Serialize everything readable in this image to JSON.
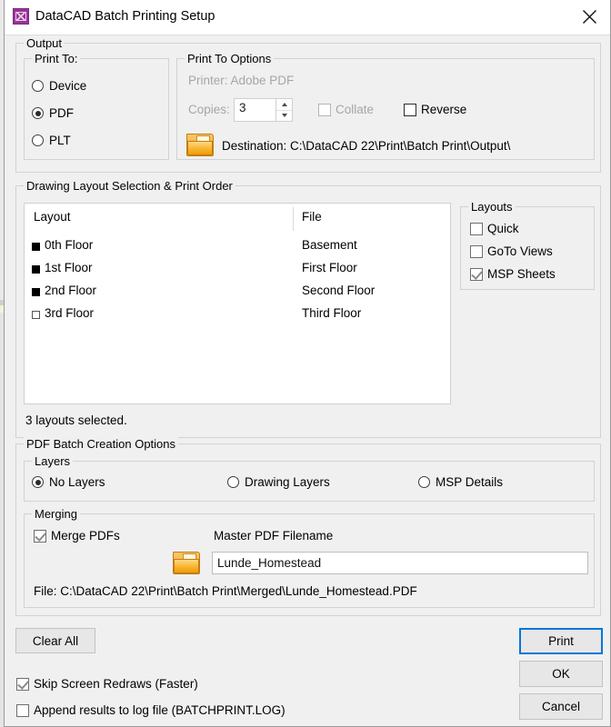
{
  "window": {
    "title": "DataCAD Batch Printing Setup",
    "app_icon": "datacad-icon",
    "close_icon": "close-icon"
  },
  "output": {
    "legend": "Output",
    "print_to": {
      "legend": "Print To:",
      "options": [
        {
          "label": "Device",
          "selected": false
        },
        {
          "label": "PDF",
          "selected": true
        },
        {
          "label": "PLT",
          "selected": false
        }
      ]
    },
    "print_to_options": {
      "legend": "Print To Options",
      "printer_text": "Printer: Adobe PDF",
      "copies_label": "Copies:",
      "copies_value": "3",
      "collate_label": "Collate",
      "collate_checked": false,
      "reverse_label": "Reverse",
      "reverse_checked": false,
      "destination_label": "Destination: C:\\DataCAD 22\\Print\\Batch Print\\Output\\",
      "folder_icon": "folder-icon"
    }
  },
  "layout_selection": {
    "legend": "Drawing Layout Selection & Print Order",
    "columns": [
      "Layout",
      "File"
    ],
    "rows": [
      {
        "layout": "0th Floor",
        "file": "Basement",
        "selected": true
      },
      {
        "layout": "1st Floor",
        "file": "First Floor",
        "selected": true
      },
      {
        "layout": "2nd Floor",
        "file": "Second Floor",
        "selected": true
      },
      {
        "layout": "3rd Floor",
        "file": "Third Floor",
        "selected": false
      }
    ],
    "status": "3 layouts selected.",
    "layouts_panel": {
      "legend": "Layouts",
      "items": [
        {
          "label": "Quick",
          "checked": false
        },
        {
          "label": "GoTo Views",
          "checked": false
        },
        {
          "label": "MSP Sheets",
          "checked": true
        }
      ]
    }
  },
  "pdf_options": {
    "legend": "PDF Batch Creation Options",
    "layers": {
      "legend": "Layers",
      "options": [
        {
          "label": "No Layers",
          "selected": true
        },
        {
          "label": "Drawing Layers",
          "selected": false
        },
        {
          "label": "MSP Details",
          "selected": false
        }
      ]
    },
    "merging": {
      "legend": "Merging",
      "merge_label": "Merge PDFs",
      "merge_checked": true,
      "master_label": "Master PDF Filename",
      "master_value": "Lunde_Homestead",
      "folder_icon": "folder-icon",
      "file_path": "File: C:\\DataCAD 22\\Print\\Batch Print\\Merged\\Lunde_Homestead.PDF"
    }
  },
  "footer": {
    "clear_all": "Clear All",
    "skip_redraws_label": "Skip Screen Redraws (Faster)",
    "skip_redraws_checked": true,
    "append_log_label": "Append results to log file (BATCHPRINT.LOG)",
    "append_log_checked": false,
    "print": "Print",
    "ok": "OK",
    "cancel": "Cancel",
    "accent_color": "#0078d7"
  }
}
